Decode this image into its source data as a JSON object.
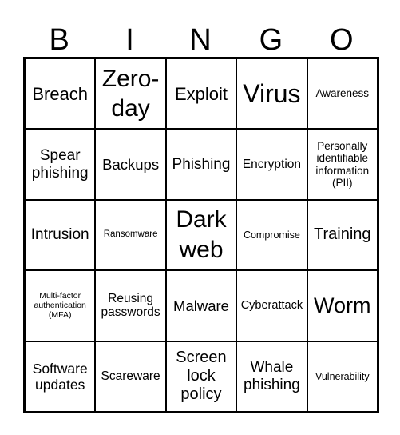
{
  "header": [
    "B",
    "I",
    "N",
    "G",
    "O"
  ],
  "cells": [
    "Breach",
    "Zero-day",
    "Exploit",
    "Virus",
    "Awareness",
    "Spear phishing",
    "Backups",
    "Phishing",
    "Encryption",
    "Personally identifiable information (PII)",
    "Intrusion",
    "Ransomware",
    "Dark web",
    "Compromise",
    "Training",
    "Multi-factor authentication (MFA)",
    "Reusing passwords",
    "Malware",
    "Cyberattack",
    "Worm",
    "Software updates",
    "Scareware",
    "Screen lock policy",
    "Whale phishing",
    "Vulnerability"
  ]
}
